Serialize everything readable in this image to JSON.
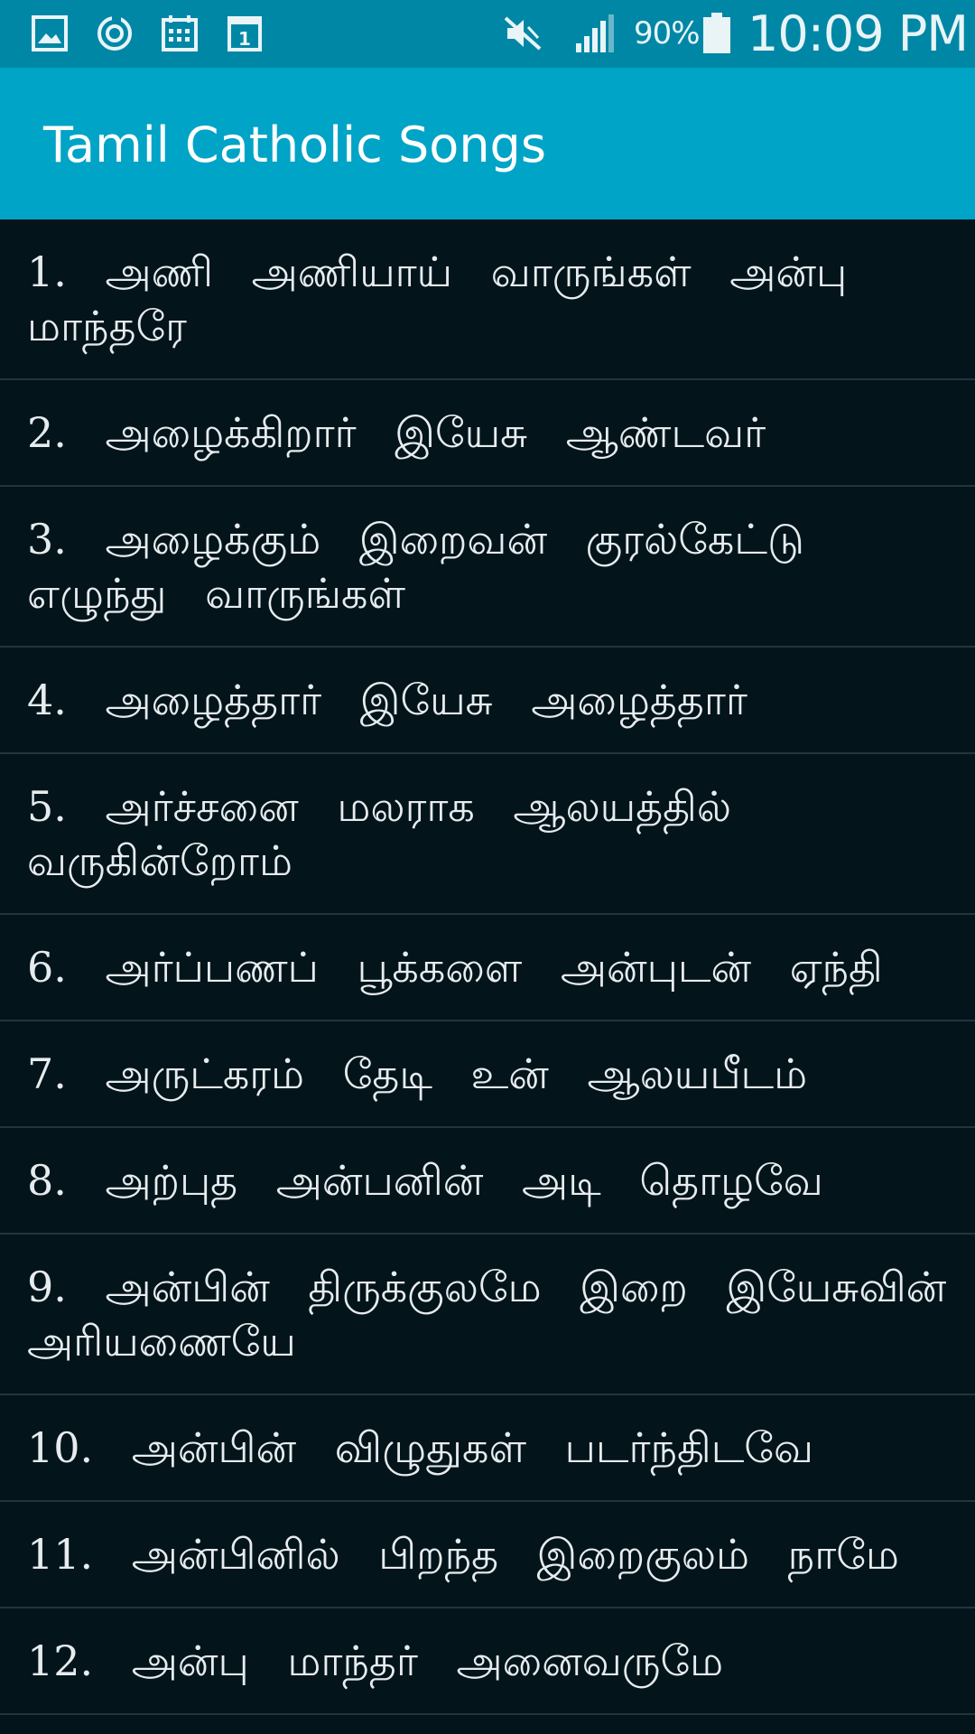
{
  "status_bar": {
    "icons": [
      "gallery-icon",
      "sync-icon",
      "calendar-icon",
      "calendar-day-icon",
      "mute-icon",
      "signal-icon",
      "battery-icon"
    ],
    "battery": "90%",
    "time": "10:09 PM"
  },
  "app_bar": {
    "title": "Tamil Catholic Songs"
  },
  "songs": [
    "1. அணி அணியாய் வாருங்கள் அன்பு மாந்தரே",
    "2. அழைக்கிறார் இயேசு ஆண்டவர்",
    "3. அழைக்கும் இறைவன் குரல்கேட்டு எழுந்து வாருங்கள்",
    "4. அழைத்தார் இயேசு அழைத்தார்",
    "5. அர்ச்சனை மலராக ஆலயத்தில் வருகின்றோம்",
    "6. அர்ப்பணப் பூக்களை அன்புடன் ஏந்தி",
    "7. அருட்கரம் தேடி உன் ஆலயபீடம்",
    "8. அற்புத அன்பனின் அடி தொழவே",
    "9. அன்பின் திருக்குலமே இறை இயேசுவின் அரியணையே",
    "10. அன்பின் விழுதுகள் படர்ந்திடவே",
    "11. அன்பினில் பிறந்த இறைகுலம் நாமே",
    "12. அன்பு மாந்தர் அனைவருமே"
  ],
  "colors": {
    "status_bar": "#0087a6",
    "app_bar": "#00a4c7",
    "background": "#04141b",
    "divider": "#22353d"
  }
}
